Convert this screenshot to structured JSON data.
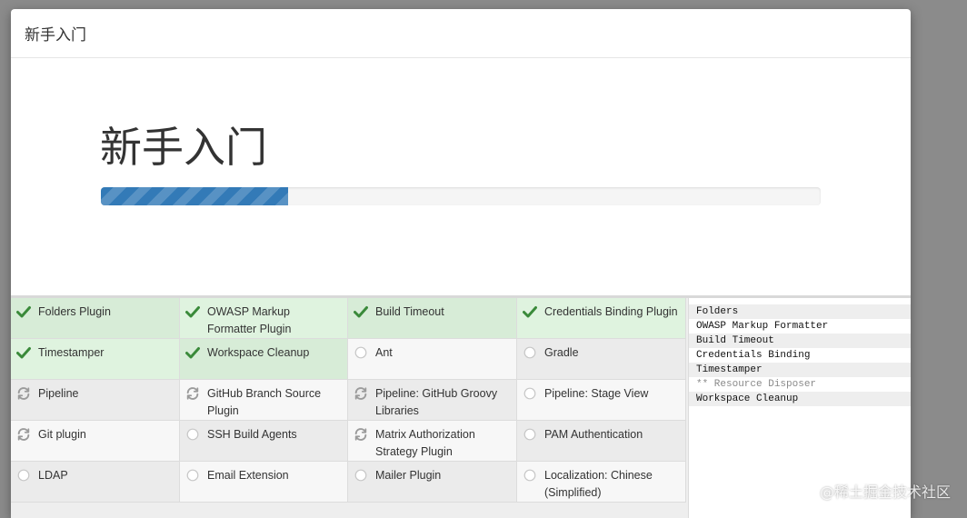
{
  "dialog": {
    "title": "新手入门"
  },
  "hero": {
    "title": "新手入门",
    "progress": 0.26,
    "progress_color": "#337ab7"
  },
  "colors": {
    "success_icon": "#3a8a3a",
    "pending_icon": "#9b9b9b",
    "empty_icon": "#c7c7c7"
  },
  "plugins": [
    {
      "name": "Folders Plugin",
      "status": "success",
      "icon": "check-icon"
    },
    {
      "name": "OWASP Markup Formatter Plugin",
      "status": "success",
      "icon": "check-icon"
    },
    {
      "name": "Build Timeout",
      "status": "success",
      "icon": "check-icon"
    },
    {
      "name": "Credentials Binding Plugin",
      "status": "success",
      "icon": "check-icon"
    },
    {
      "name": "Timestamper",
      "status": "success",
      "icon": "check-icon"
    },
    {
      "name": "Workspace Cleanup",
      "status": "success",
      "icon": "check-icon"
    },
    {
      "name": "Ant",
      "status": "none",
      "icon": "empty-circle-icon"
    },
    {
      "name": "Gradle",
      "status": "none",
      "icon": "empty-circle-icon"
    },
    {
      "name": "Pipeline",
      "status": "installing",
      "icon": "refresh-icon"
    },
    {
      "name": "GitHub Branch Source Plugin",
      "status": "installing",
      "icon": "refresh-icon"
    },
    {
      "name": "Pipeline: GitHub Groovy Libraries",
      "status": "installing",
      "icon": "refresh-icon"
    },
    {
      "name": "Pipeline: Stage View",
      "status": "none",
      "icon": "empty-circle-icon"
    },
    {
      "name": "Git plugin",
      "status": "installing",
      "icon": "refresh-icon"
    },
    {
      "name": "SSH Build Agents",
      "status": "none",
      "icon": "empty-circle-icon"
    },
    {
      "name": "Matrix Authorization Strategy Plugin",
      "status": "installing",
      "icon": "refresh-icon"
    },
    {
      "name": "PAM Authentication",
      "status": "none",
      "icon": "empty-circle-icon"
    },
    {
      "name": "LDAP",
      "status": "none",
      "icon": "empty-circle-icon"
    },
    {
      "name": "Email Extension",
      "status": "none",
      "icon": "empty-circle-icon"
    },
    {
      "name": "Mailer Plugin",
      "status": "none",
      "icon": "empty-circle-icon"
    },
    {
      "name": "Localization: Chinese (Simplified)",
      "status": "none",
      "icon": "empty-circle-icon"
    }
  ],
  "log": [
    {
      "text": "Folders",
      "dim": false
    },
    {
      "text": "OWASP Markup Formatter",
      "dim": false
    },
    {
      "text": "Build Timeout",
      "dim": false
    },
    {
      "text": "Credentials Binding",
      "dim": false
    },
    {
      "text": "Timestamper",
      "dim": false
    },
    {
      "text": "** Resource Disposer",
      "dim": true
    },
    {
      "text": "Workspace Cleanup",
      "dim": false
    }
  ],
  "watermark": "@稀土掘金技术社区"
}
